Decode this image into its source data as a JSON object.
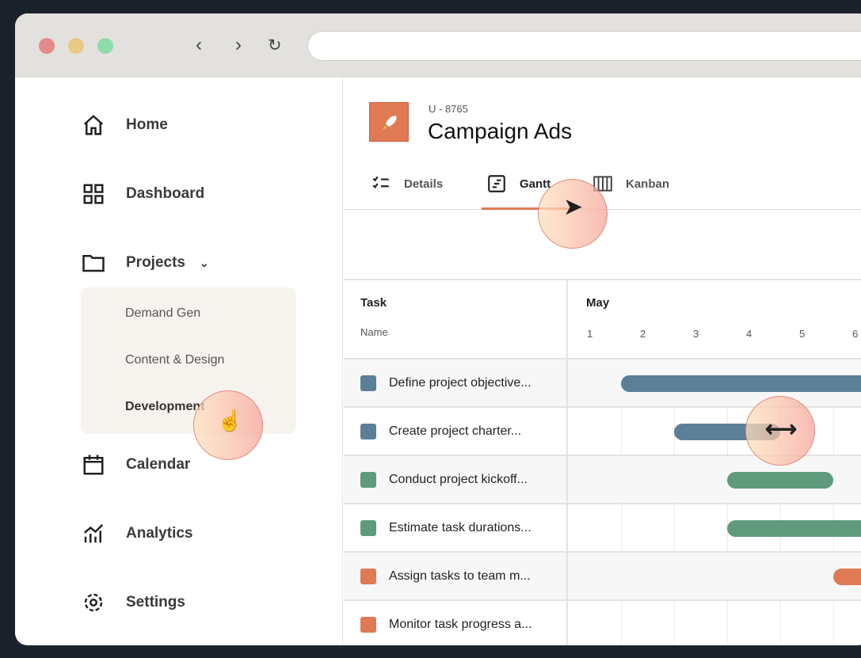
{
  "browser": {
    "traffic_colors": [
      "#e58a8a",
      "#e8c985",
      "#8fdcab"
    ],
    "back": "‹",
    "forward": "›",
    "reload": "↻"
  },
  "sidebar": {
    "items": [
      {
        "label": "Home",
        "icon": "home-icon"
      },
      {
        "label": "Dashboard",
        "icon": "grid-icon"
      },
      {
        "label": "Projects",
        "icon": "folder-icon"
      },
      {
        "label": "Calendar",
        "icon": "calendar-icon"
      },
      {
        "label": "Analytics",
        "icon": "analytics-icon"
      },
      {
        "label": "Settings",
        "icon": "gear-icon"
      }
    ],
    "projects_sub": [
      "Demand Gen",
      "Content & Design",
      "Development"
    ]
  },
  "project": {
    "id": "U - 8765",
    "title": "Campaign Ads",
    "icon": "rocket-icon",
    "color": "#e07a55"
  },
  "tabs": [
    {
      "label": "Details"
    },
    {
      "label": "Gantt",
      "active": true
    },
    {
      "label": "Kanban"
    }
  ],
  "gantt": {
    "col_task": "Task",
    "col_name": "Name",
    "month": "May",
    "days": [
      "1",
      "2",
      "3",
      "4",
      "5",
      "6"
    ],
    "tasks": [
      {
        "name": "Define project objective...",
        "color": "#5a7f96",
        "start": 2,
        "end": 7.5
      },
      {
        "name": "Create project charter...",
        "color": "#5a7f96",
        "start": 3,
        "end": 5
      },
      {
        "name": "Conduct project kickoff...",
        "color": "#5f9a7c",
        "start": 4,
        "end": 6
      },
      {
        "name": "Estimate task durations...",
        "color": "#5f9a7c",
        "start": 4,
        "end": 7.5
      },
      {
        "name": "Assign tasks to team m...",
        "color": "#e07a55",
        "start": 6,
        "end": 7.5
      },
      {
        "name": "Monitor task progress a...",
        "color": "#e07a55",
        "start": null,
        "end": null
      }
    ]
  }
}
